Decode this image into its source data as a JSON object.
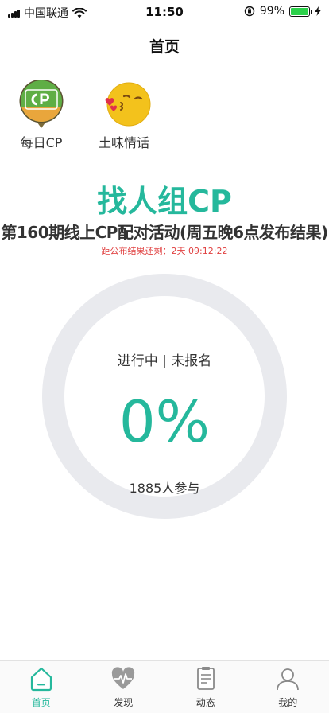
{
  "status_bar": {
    "carrier": "中国联通",
    "time": "11:50",
    "battery": "99%",
    "battery_level": 0.99
  },
  "nav": {
    "title": "首页"
  },
  "shortcuts": [
    {
      "label": "每日CP",
      "icon": "cp-badge-icon"
    },
    {
      "label": "土味情话",
      "icon": "kiss-emoji-icon"
    }
  ],
  "activity": {
    "headline": "找人组CP",
    "title": "第160期线上CP配对活动(周五晚6点发布结果)",
    "countdown": "距公布结果还剩：2天 09:12:22",
    "status": "进行中 | 未报名",
    "percent": "0%",
    "progress": 0,
    "participants": "1885人参与"
  },
  "tabs": [
    {
      "label": "首页",
      "icon": "home-icon",
      "active": true
    },
    {
      "label": "发现",
      "icon": "heartbeat-icon",
      "active": false
    },
    {
      "label": "动态",
      "icon": "document-icon",
      "active": false
    },
    {
      "label": "我的",
      "icon": "user-icon",
      "active": false
    }
  ],
  "colors": {
    "accent": "#25b89c",
    "countdown": "#e04040",
    "ring_track": "#e9eaee",
    "battery": "#2bd14a"
  }
}
